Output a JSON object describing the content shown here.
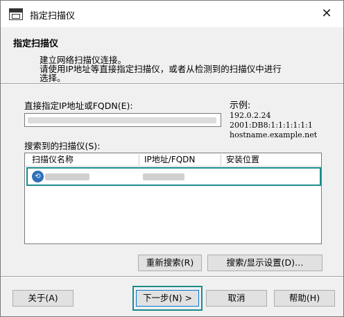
{
  "window": {
    "title": "指定扫描仪",
    "close_glyph": "✕"
  },
  "header": {
    "title": "指定扫描仪",
    "desc_line1": "建立网络扫描仪连接。",
    "desc_line2": "请使用IP地址等直接指定扫描仪，或者从检测到的扫描仪中进行",
    "desc_line3": "选择。"
  },
  "address": {
    "label": "直接指定IP地址或FQDN(E):",
    "value": ""
  },
  "example": {
    "title": "示例:",
    "lines": [
      "192.0.2.24",
      "2001:DB8:1:1:1:1:1:1",
      "hostname.example.net"
    ]
  },
  "found": {
    "label": "搜索到的扫描仪(S):",
    "columns": [
      "扫描仪名称",
      "IP地址/FQDN",
      "安装位置"
    ],
    "rows": [
      {
        "name": "",
        "ip": "",
        "location": "",
        "selected": true
      }
    ]
  },
  "buttons": {
    "research": "重新搜索(R)",
    "search_settings": "搜索/显示设置(D)…",
    "about": "关于(A)",
    "next": "下一步(N) >",
    "cancel": "取消",
    "help": "帮助(H)"
  },
  "colors": {
    "highlight": "#1a8c8c",
    "dialog_bg": "#f0f0f0"
  }
}
